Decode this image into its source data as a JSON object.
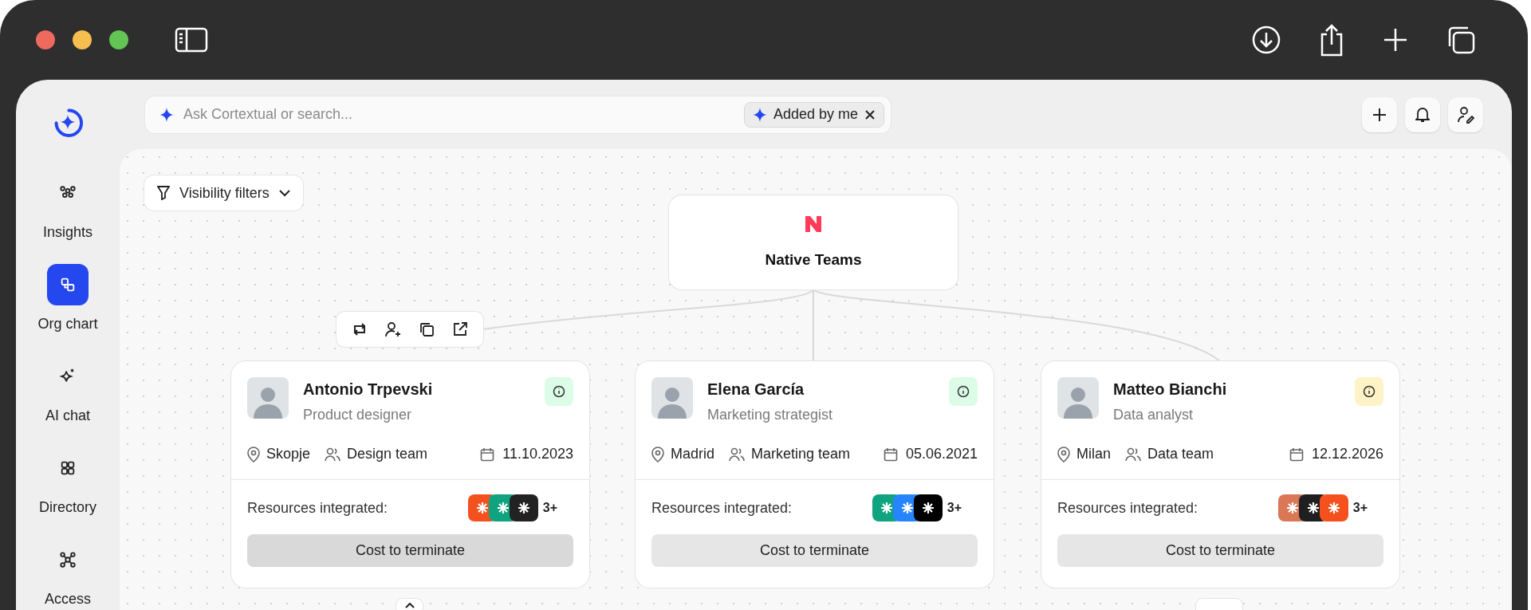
{
  "sidebar": {
    "items": [
      {
        "kind": "insights",
        "label": "Insights",
        "selected": false
      },
      {
        "kind": "org",
        "label": "Org chart",
        "selected": true
      },
      {
        "kind": "ai",
        "label": "AI chat",
        "selected": false
      },
      {
        "kind": "directory",
        "label": "Directory",
        "selected": false
      },
      {
        "kind": "access",
        "label": "Access",
        "selected": false
      }
    ]
  },
  "search": {
    "placeholder": "Ask Cortextual or search...",
    "filter_chip": "Added by me"
  },
  "canvas": {
    "filter_button": "Visibility filters",
    "root": {
      "name": "Native Teams"
    },
    "people": [
      {
        "name": "Antonio Trpevski",
        "role": "Product designer",
        "location": "Skopje",
        "team": "Design team",
        "date": "11.10.2023",
        "color": "#dcfce7",
        "selected": true,
        "resources_label": "Resources integrated:",
        "resources": [
          {
            "color": "#f4511e"
          },
          {
            "color": "#10a37f"
          },
          {
            "color": "#222222"
          }
        ],
        "resources_more": "3+",
        "action": "Cost to terminate"
      },
      {
        "name": "Elena García",
        "role": "Marketing strategist",
        "location": "Madrid",
        "team": "Marketing team",
        "date": "05.06.2021",
        "color": "#dcfce7",
        "selected": false,
        "resources_label": "Resources integrated:",
        "resources": [
          {
            "color": "#10a37f"
          },
          {
            "color": "#2684ff"
          },
          {
            "color": "#000000"
          }
        ],
        "resources_more": "3+",
        "action": "Cost to terminate"
      },
      {
        "name": "Matteo Bianchi",
        "role": "Data analyst",
        "location": "Milan",
        "team": "Data team",
        "date": "12.12.2026",
        "color": "#fef3c7",
        "selected": false,
        "resources_label": "Resources integrated:",
        "resources": [
          {
            "color": "#d97757"
          },
          {
            "color": "#1f1f1f"
          },
          {
            "color": "#f4511e"
          }
        ],
        "resources_more": "3+",
        "action": "Cost to terminate"
      }
    ]
  }
}
